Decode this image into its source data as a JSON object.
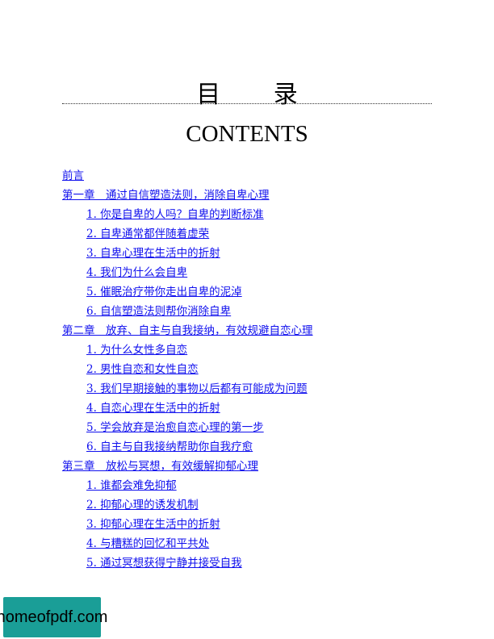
{
  "title": "目 录",
  "subtitle": "CONTENTS",
  "toc": {
    "preface": "前言",
    "ch1": "第一章　通过自信塑造法则，消除自卑心理",
    "ch1_1": "1. 你是自卑的人吗？自卑的判断标准",
    "ch1_2": "2. 自卑通常都伴随着虚荣",
    "ch1_3": "3. 自卑心理在生活中的折射",
    "ch1_4": "4. 我们为什么会自卑",
    "ch1_5": "5. 催眠治疗带你走出自卑的泥淖",
    "ch1_6": "6. 自信塑造法则帮你消除自卑",
    "ch2": "第二章　放弃、自主与自我接纳，有效规避自恋心理",
    "ch2_1": "1. 为什么女性多自恋",
    "ch2_2": "2. 男性自恋和女性自恋",
    "ch2_3": "3. 我们早期接触的事物以后都有可能成为问题",
    "ch2_4": "4. 自恋心理在生活中的折射",
    "ch2_5": "5. 学会放弃是治愈自恋心理的第一步",
    "ch2_6": "6. 自主与自我接纳帮助你自我疗愈",
    "ch3": "第三章　放松与冥想，有效缓解抑郁心理",
    "ch3_1": "1. 谁都会难免抑郁",
    "ch3_2": "2. 抑郁心理的诱发机制",
    "ch3_3": "3. 抑郁心理在生活中的折射",
    "ch3_4": "4. 与糟糕的回忆和平共处",
    "ch3_5": "5. 通过冥想获得宁静并接受自我"
  },
  "watermark": "homeofpdf.com",
  "colors": {
    "link": "#1010ee",
    "watermark_bg": "#1a9e97"
  }
}
